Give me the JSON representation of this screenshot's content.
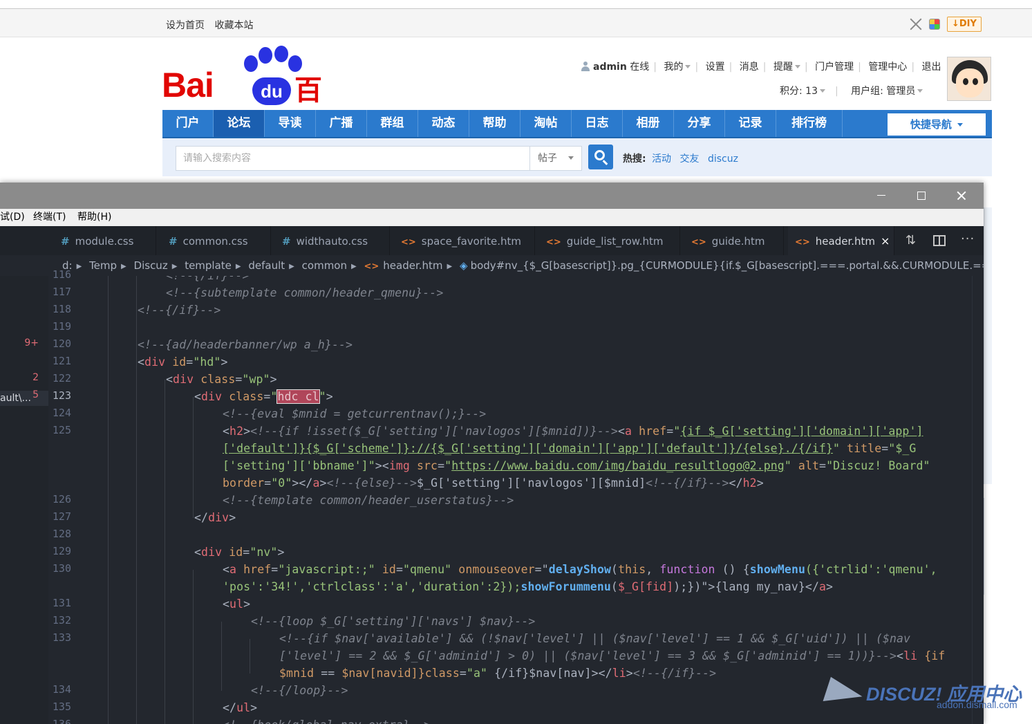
{
  "site": {
    "top_links": [
      "设为首页",
      "收藏本站"
    ],
    "diy_label": "↓DIY",
    "logo": {
      "latin": "Bai",
      "du": "du",
      "chinese": "百度"
    },
    "user": {
      "name": "admin",
      "status": "在线",
      "menu": [
        "我的",
        "设置",
        "消息",
        "提醒",
        "门户管理",
        "管理中心",
        "退出"
      ],
      "points": "积分: 13",
      "group": "用户组: 管理员"
    },
    "nav": [
      "门户",
      "论坛",
      "导读",
      "广播",
      "群组",
      "动态",
      "帮助",
      "淘帖",
      "日志",
      "相册",
      "分享",
      "记录",
      "排行榜"
    ],
    "nav_active": "论坛",
    "quick_nav": "快捷导航",
    "search": {
      "placeholder": "请输入搜索内容",
      "type": "帖子",
      "hot_label": "热搜:",
      "hot": [
        "活动",
        "交友",
        "discuz"
      ]
    },
    "accent_color": "#2b7acd",
    "logo_red": "#e10602",
    "logo_blue": "#2932e1"
  },
  "editor": {
    "menu": [
      "试(D)",
      "终端(T)",
      "帮助(H)"
    ],
    "tabs": [
      {
        "label": "module.css",
        "icon": "#"
      },
      {
        "label": "common.css",
        "icon": "#"
      },
      {
        "label": "widthauto.css",
        "icon": "#"
      },
      {
        "label": "space_favorite.htm",
        "icon": "<>"
      },
      {
        "label": "guide_list_row.htm",
        "icon": "<>"
      },
      {
        "label": "guide.htm",
        "icon": "<>"
      },
      {
        "label": "header.htm",
        "icon": "<>",
        "active": true
      }
    ],
    "breadcrumbs": [
      "d:",
      "Temp",
      "Discuz",
      "template",
      "default",
      "common",
      "header.htm",
      "body#nv_{$_G[basescript]}.pg_{CURMODULE}{if.$_G[basescript].===.portal.&&.CURMODULE.===.list.&&.!emp"
    ],
    "side": {
      "label": "ault\\...",
      "badges": [
        {
          "value": "9+",
          "line": "120"
        },
        {
          "value": "2",
          "line": "122"
        },
        {
          "value": "5",
          "line": "123"
        }
      ]
    },
    "line_numbers": [
      "116",
      "117",
      "118",
      "119",
      "120",
      "121",
      "122",
      "123",
      "124",
      "125",
      "",
      "",
      "",
      "126",
      "127",
      "128",
      "129",
      "130",
      "",
      "131",
      "132",
      "133",
      "",
      "",
      "134",
      "135",
      "136"
    ],
    "current_line": "123",
    "code": {
      "l116": "<!--{/if}-->",
      "l117": "<!--{subtemplate common/header_qmenu}-->",
      "l118": "<!--{/if}-->",
      "l120": "<!--{ad/headerbanner/wp a_h}-->",
      "l121_tag": "div",
      "l121_attr": "id",
      "l121_val": "\"hd\"",
      "l122_tag": "div",
      "l122_attr": "class",
      "l122_val": "\"wp\"",
      "l123_tag": "div",
      "l123_attr": "class",
      "l123_sel": "hdc cl",
      "l124": "<!--{eval $mnid = getcurrentnav();}-->",
      "l125a_c": "<!--{if !isset($_G['setting']['navlogos'][$mnid])}-->",
      "l125a_href": "{if $_G['setting']['domain']['app']",
      "l125b": "['default']}{$_G['scheme']}://{$_G['setting']['domain']['app']['default']}/{else}./{/if}",
      "l125b_title": "\"$_G",
      "l125c_a": "['setting']['bbname']\"",
      "l125c_src": "https://www.baidu.com/img/baidu_resultlogo@2.png",
      "l125c_alt": "\"Discuz! Board\"",
      "l125d_border": "\"0\"",
      "l125d_else": "<!--{else}-->",
      "l125d_var": "$_G['setting']['navlogos'][$mnid]",
      "l125d_endif": "<!--{/if}-->",
      "l126": "<!--{template common/header_userstatus}-->",
      "l129_val": "\"nv\"",
      "l130a_href": "\"javascript:;\"",
      "l130a_id": "\"qmenu\"",
      "l130a_fn1": "delayShow",
      "l130a_this": "this",
      "l130a_kw": "function",
      "l130a_fn2": "showMenu",
      "l130a_args": "({'ctrlid':'qmenu',",
      "l130b_args": "'pos':'34!','ctrlclass':'a','duration':2});",
      "l130b_fn": "showForummenu",
      "l130b_var": "$_G[fid]",
      "l130b_end": "{lang my_nav}",
      "l132": "<!--{loop $_G['setting']['navs'] $nav}-->",
      "l133a": "<!--{if $nav['available'] && (!$nav['level'] || ($nav['level'] == 1 && $_G['uid']) || ($nav",
      "l133b": "['level'] == 2 && $_G['adminid'] > 0) || ($nav['level'] == 3 && $_G['adminid'] == 1))}-->",
      "l133b_if": "{if",
      "l133c_var": "$mnid",
      "l133c_var2": "$nav[navid]",
      "l133c_cls": "\"a\"",
      "l133c_mid": "{/if}$nav[nav]",
      "l133c_endif": "<!--{/if}-->",
      "l134": "<!--{/loop}-->",
      "l136": "<!--{hook/global_nav_extra}-->"
    }
  },
  "watermark": {
    "brand": "DISCUZ! 应用中心",
    "url": "addon.dismall.com"
  }
}
